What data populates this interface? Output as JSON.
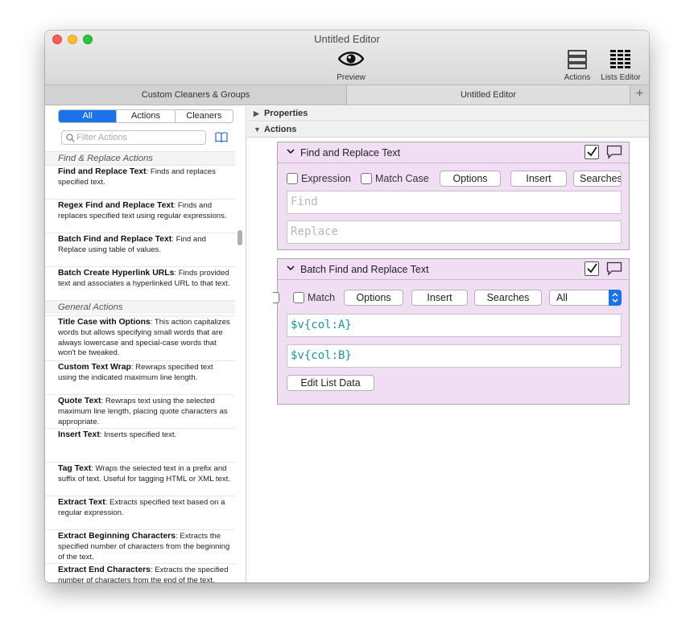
{
  "window": {
    "title": "Untitled Editor"
  },
  "toolbar": {
    "preview_label": "Preview",
    "actions_label": "Actions",
    "lists_label": "Lists Editor"
  },
  "tabs": [
    {
      "label": "Custom Cleaners & Groups"
    },
    {
      "label": "Untitled Editor"
    }
  ],
  "tab_add": "+",
  "sidebar": {
    "segments": [
      "All",
      "Actions",
      "Cleaners"
    ],
    "filter_placeholder": "Filter Actions",
    "headers": {
      "find_replace": "Find & Replace Actions",
      "general": "General Actions"
    },
    "items": [
      {
        "name": "Find and Replace Text",
        "desc": ": Finds and replaces specified text."
      },
      {
        "name": "Regex Find and Replace Text",
        "desc": ": Finds and replaces specified text using regular expressions."
      },
      {
        "name": "Batch Find and Replace Text",
        "desc": ": Find and Replace using table of values."
      },
      {
        "name": "Batch Create Hyperlink URLs",
        "desc": ": Finds provided text and associates a hyperlinked URL to that text."
      },
      {
        "name": "Title Case with Options",
        "desc": ": This action capitalizes words but allows specifying small words that are always lowercase and special-case words that won't be tweaked."
      },
      {
        "name": "Custom Text Wrap",
        "desc": ": Rewraps specified text using the indicated maximum line length."
      },
      {
        "name": "Quote Text",
        "desc": ": Rewraps text using the selected maximum line length, placing quote characters as appropriate."
      },
      {
        "name": "Insert Text",
        "desc": ": Inserts specified text."
      },
      {
        "name": "Tag Text",
        "desc": ": Wraps the selected text in a prefix and suffix of text. Useful for tagging HTML or XML text."
      },
      {
        "name": "Extract Text",
        "desc": ": Extracts specified text based on a regular expression."
      },
      {
        "name": "Extract Beginning Characters",
        "desc": ": Extracts the specified number of characters from the beginning of the text."
      },
      {
        "name": "Extract End Characters",
        "desc": ": Extracts the specified number of characters from the end of the text."
      }
    ]
  },
  "main": {
    "properties_label": "Properties",
    "actions_label": "Actions",
    "card1": {
      "title": "Find and Replace Text",
      "expression_label": "Expression",
      "match_case_label": "Match Case",
      "options_label": "Options",
      "insert_label": "Insert",
      "searches_label": "Searches",
      "find_placeholder": "Find",
      "replace_placeholder": "Replace"
    },
    "card2": {
      "title": "Batch Find and Replace Text",
      "match_label": "Match",
      "options_label": "Options",
      "insert_label": "Insert",
      "searches_label": "Searches",
      "scope_value": "All",
      "find_value": "$v{col:A}",
      "replace_value": "$v{col:B}",
      "edit_list_label": "Edit List Data"
    }
  },
  "colors": {
    "accent": "#1a73e8",
    "card_bg": "#f1def5",
    "token": "#1a9a8a"
  }
}
